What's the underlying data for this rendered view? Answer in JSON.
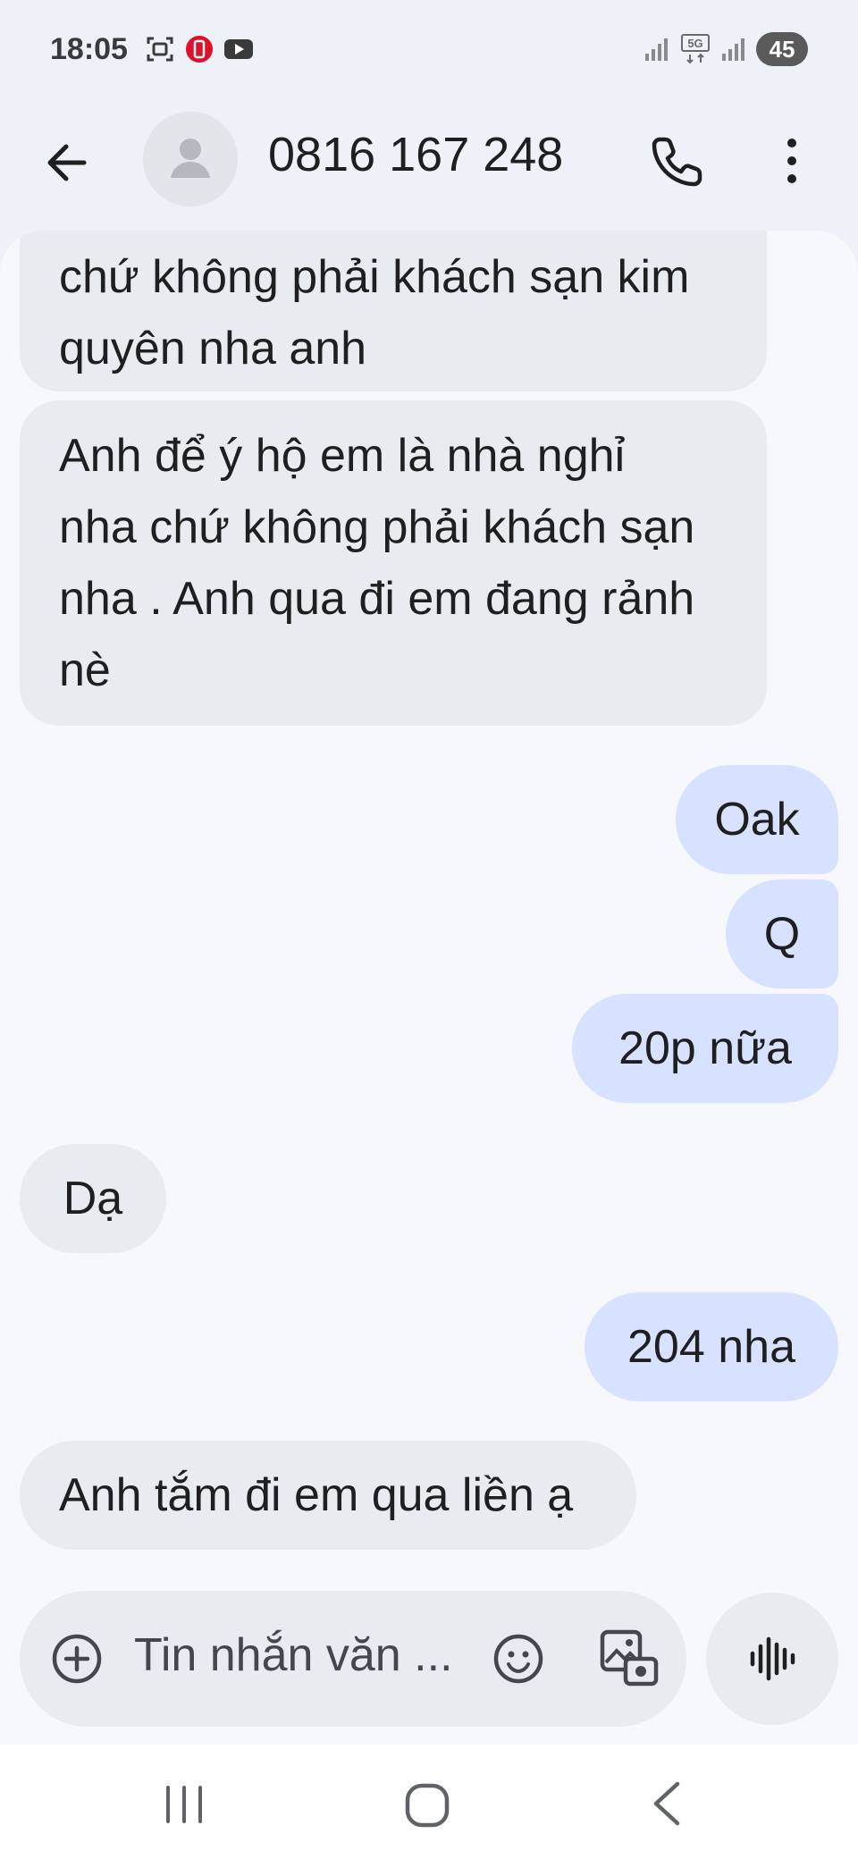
{
  "status_bar": {
    "time": "18:05",
    "icons_left": [
      "screenshot-icon",
      "app-notification-icon",
      "youtube-icon"
    ],
    "icons_right": [
      "signal-icon",
      "5g-icon",
      "signal-icon"
    ],
    "battery": "45"
  },
  "header": {
    "contact": "0816 167 248",
    "back_icon": "arrow-left-icon",
    "call_icon": "phone-icon",
    "more_icon": "more-vert-icon"
  },
  "messages": [
    {
      "direction": "incoming",
      "lines": [
        "chứ không phải khách sạn kim",
        "quyên nha anh"
      ]
    },
    {
      "direction": "incoming",
      "lines": [
        "Anh để ý hộ em là nhà nghỉ",
        "nha chứ không phải khách sạn",
        "nha . Anh qua đi em đang rảnh",
        "nè"
      ]
    },
    {
      "direction": "outgoing",
      "lines": [
        "Oak"
      ]
    },
    {
      "direction": "outgoing",
      "lines": [
        "Q"
      ]
    },
    {
      "direction": "outgoing",
      "lines": [
        "20p nữa"
      ]
    },
    {
      "direction": "incoming",
      "lines": [
        "Dạ"
      ]
    },
    {
      "direction": "outgoing",
      "lines": [
        "204 nha"
      ]
    },
    {
      "direction": "incoming",
      "lines": [
        "Anh tắm đi em qua liền ạ"
      ]
    }
  ],
  "composer": {
    "placeholder": "Tin nhắn văn ...",
    "icons": [
      "add-circle-icon",
      "emoji-icon",
      "gallery-icon",
      "voice-icon"
    ]
  },
  "colors": {
    "incoming_bubble": "#e8ebf0",
    "outgoing_bubble": "#d6e2ff",
    "background": "#f6f8fc"
  }
}
